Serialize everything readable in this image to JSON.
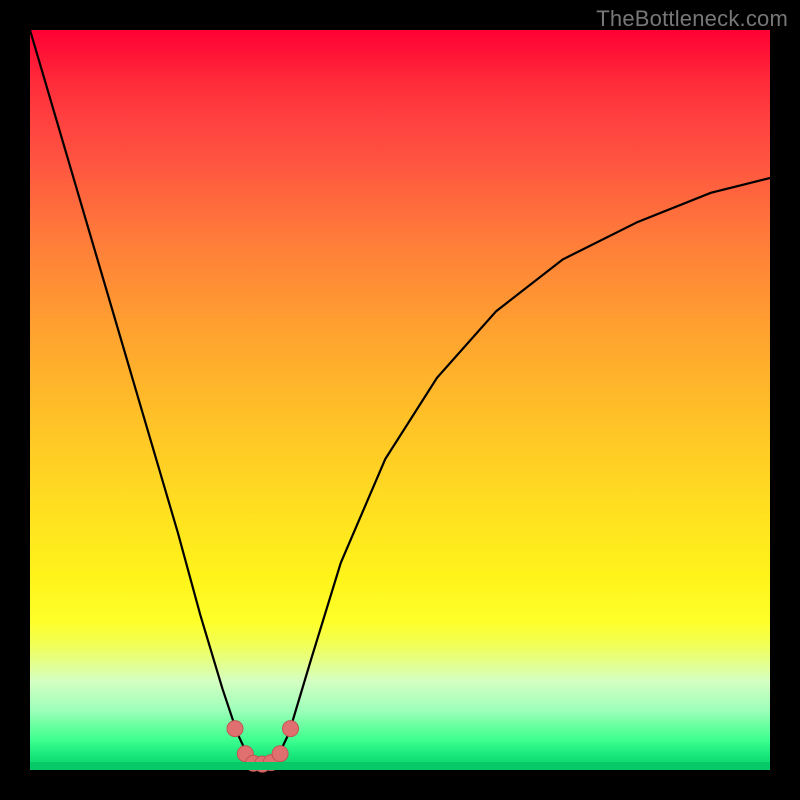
{
  "watermark": "TheBottleneck.com",
  "colors": {
    "background_black": "#000000",
    "gradient_top": "#ff0033",
    "gradient_bottom": "#08c968",
    "curve": "#000000",
    "dot_fill": "#e07070",
    "dot_stroke": "#c05555",
    "watermark_text": "#777777"
  },
  "chart_data": {
    "type": "line",
    "title": "",
    "xlabel": "",
    "ylabel": "",
    "xlim": [
      0,
      100
    ],
    "ylim": [
      0,
      100
    ],
    "grid": false,
    "legend": false,
    "series": [
      {
        "name": "curve",
        "x": [
          0,
          5,
          10,
          15,
          20,
          23,
          26,
          28,
          29.5,
          30.5,
          32,
          33.5,
          35,
          38,
          42,
          48,
          55,
          63,
          72,
          82,
          92,
          100
        ],
        "y": [
          100,
          83,
          66,
          49,
          32,
          21,
          11,
          5,
          1.8,
          0.8,
          0.8,
          1.8,
          5,
          15,
          28,
          42,
          53,
          62,
          69,
          74,
          78,
          80
        ]
      }
    ],
    "minimum": {
      "x": 31,
      "y": 0.8
    },
    "dots": [
      {
        "x": 27.7,
        "y": 5.6
      },
      {
        "x": 29.1,
        "y": 2.2
      },
      {
        "x": 30.2,
        "y": 0.9
      },
      {
        "x": 31.4,
        "y": 0.8
      },
      {
        "x": 32.6,
        "y": 1.0
      },
      {
        "x": 33.8,
        "y": 2.2
      },
      {
        "x": 35.2,
        "y": 5.6
      }
    ],
    "dot_radius_px": 8
  }
}
